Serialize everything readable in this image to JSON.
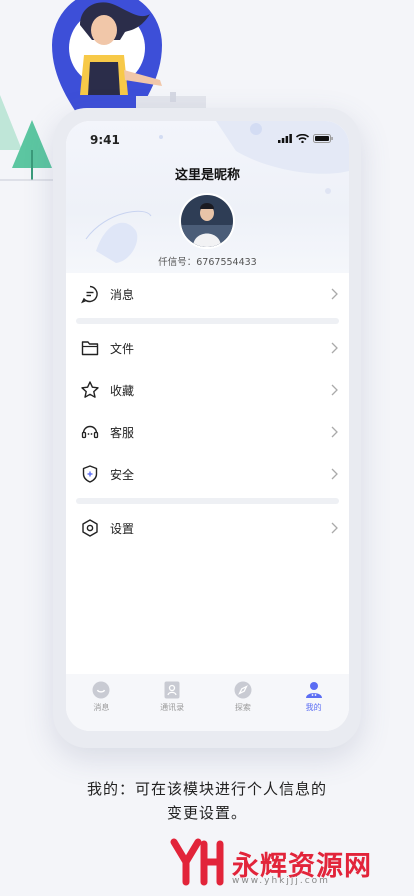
{
  "status": {
    "time": "9:41"
  },
  "profile": {
    "nickname": "这里是昵称",
    "id_label": "仟信号：6767554433"
  },
  "menu": {
    "messages": "消息",
    "files": "文件",
    "favorites": "收藏",
    "support": "客服",
    "security": "安全",
    "settings": "设置"
  },
  "tabs": [
    {
      "label": "消息",
      "icon": "chat-icon"
    },
    {
      "label": "通讯录",
      "icon": "contacts-icon"
    },
    {
      "label": "探索",
      "icon": "compass-icon"
    },
    {
      "label": "我的",
      "icon": "profile-icon",
      "active": true
    }
  ],
  "caption": {
    "line1": "我的：可在该模块进行个人信息的",
    "line2": "变更设置。"
  },
  "watermark": {
    "name": "永辉资源网",
    "url": "www.yhkjjj.com"
  },
  "colors": {
    "accent": "#5b6df3",
    "brand_red": "#e2243a",
    "illustration_blue": "#3d4fd8"
  }
}
